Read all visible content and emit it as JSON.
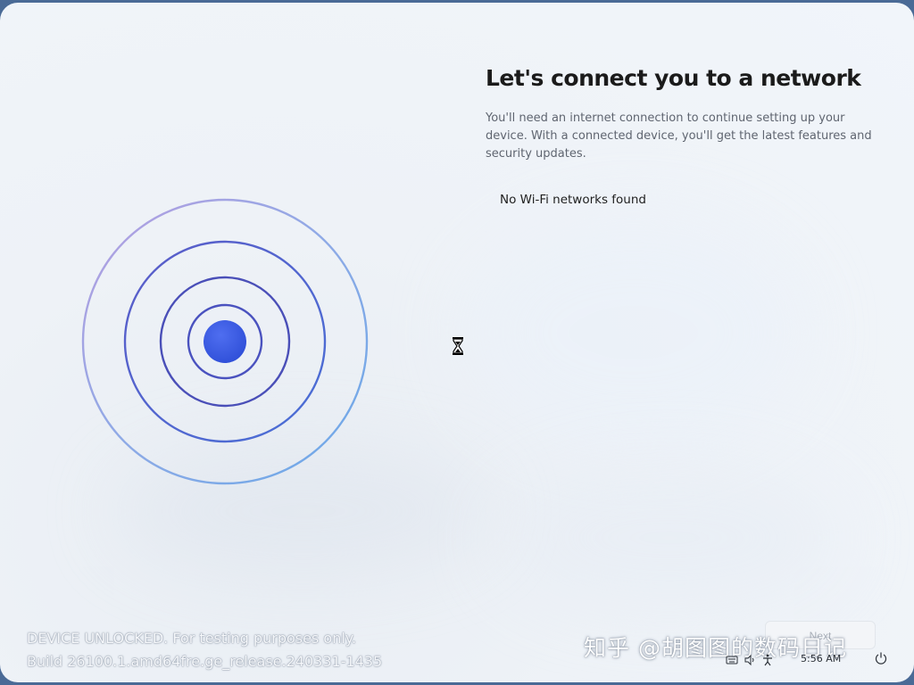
{
  "page": {
    "title": "Let's connect you to a network",
    "description": "You'll need an internet connection to continue setting up your device. With a connected device, you'll get the latest features and security updates.",
    "wifi_status": "No Wi-Fi networks found"
  },
  "footer": {
    "next_label": "Next",
    "clock": "5:56 AM"
  },
  "overlay": {
    "device_notice": "DEVICE UNLOCKED. For testing purposes only.",
    "build": "Build 26100.1.amd64fre.ge_release.240331-1435",
    "source_watermark": "知乎 @胡图图的数码日记"
  },
  "icons": {
    "network_illustration": "network-rings-icon",
    "cursor": "hourglass-icon",
    "language": "keyboard-language-icon",
    "volume": "volume-icon",
    "accessibility": "accessibility-icon",
    "power": "power-icon"
  },
  "colors": {
    "ring_outer": "#9fa8e0",
    "ring_inner": "#4a4fb8",
    "dot": "#3c5ce0",
    "title": "#1b1b1b",
    "body_text": "#5f6570"
  }
}
